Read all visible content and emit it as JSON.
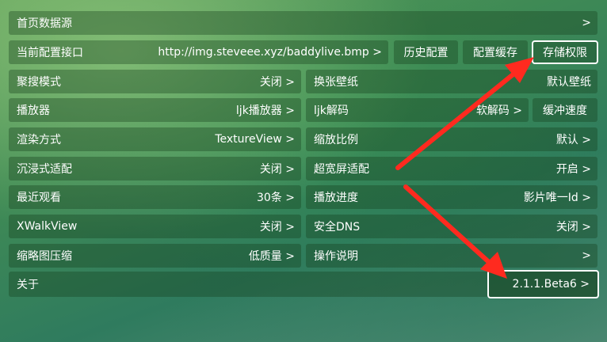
{
  "accent_color": "#ff2a1f",
  "rows": [
    {
      "label": "首页数据源",
      "value": ">"
    },
    {
      "label": "当前配置接口",
      "value": "http://img.steveee.xyz/baddylive.bmp >"
    },
    {
      "left": {
        "label": "聚搜模式",
        "value": "关闭 >"
      },
      "right": {
        "label": "换张壁纸",
        "value": "默认壁纸"
      }
    },
    {
      "left": {
        "label": "播放器",
        "value": "ljk播放器 >"
      },
      "right": {
        "label": "ljk解码",
        "value": "软解码 >"
      }
    },
    {
      "left": {
        "label": "渲染方式",
        "value": "TextureView >"
      },
      "right": {
        "label": "缩放比例",
        "value": "默认 >"
      }
    },
    {
      "left": {
        "label": "沉浸式适配",
        "value": "关闭 >"
      },
      "right": {
        "label": "超宽屏适配",
        "value": "开启 >"
      }
    },
    {
      "left": {
        "label": "最近观看",
        "value": "30条 >"
      },
      "right": {
        "label": "播放进度",
        "value": "影片唯一Id >"
      }
    },
    {
      "left": {
        "label": "XWalkView",
        "value": "关闭 >"
      },
      "right": {
        "label": "安全DNS",
        "value": "关闭 >"
      }
    },
    {
      "left": {
        "label": "缩略图压缩",
        "value": "低质量 >"
      },
      "right": {
        "label": "操作说明",
        "value": ">"
      }
    },
    {
      "label": "关于",
      "value": "2.1.1.Beta6 >"
    }
  ],
  "buttons": {
    "history": "历史配置",
    "cache": "配置缓存",
    "storage": "存储权限",
    "buffer": "缓冲速度"
  }
}
